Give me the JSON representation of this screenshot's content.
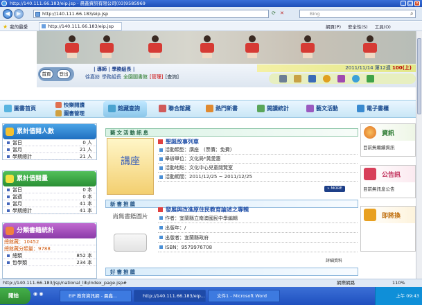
{
  "browser": {
    "title": "http://140.111.66.183/eip.jsp - 晨鑫資訊有限公司(03)9585969",
    "url": "http://140.111.66.183/eip.jsp",
    "search_placeholder": "Bing",
    "favorites": "我的最愛",
    "tab": "http://140.111.66.183/eip.jsp",
    "toolbar": [
      "網頁(P)",
      "安全性(S)",
      "工具(O)"
    ],
    "status": "http://140.111.66.183/jsp/national_lib/index_page.jsp#",
    "status_zone": "網際網路",
    "zoom": "110%"
  },
  "header": {
    "home": "首頁",
    "logout": "登出",
    "role": "| 導師 | 學務組長 |",
    "user_name": "徐嘉紡",
    "user_role_text": "學務組長",
    "library": "全園圖書館",
    "manage": "[管理]",
    "query": "[查詢]",
    "date": "2011/11/14 第12週 ",
    "date_extra": "100(上)"
  },
  "menu": {
    "home": "圖書首頁",
    "fast_read": "快樂閱讀",
    "lib_manage": "圖書管理",
    "items": [
      "館藏查詢",
      "聯合館藏",
      "熱門新書",
      "閱讀統計",
      "藝文活動",
      "電子書櫃"
    ]
  },
  "left": {
    "visitors": {
      "title": "累計借閱人數",
      "rows": [
        {
          "label": "當日",
          "value": "0 人"
        },
        {
          "label": "當月",
          "value": "21 人"
        },
        {
          "label": "學期總計",
          "value": "21 人"
        }
      ]
    },
    "borrow": {
      "title": "累計借閱量",
      "rows": [
        {
          "label": "當日",
          "value": "0 本"
        },
        {
          "label": "當週",
          "value": "0 本"
        },
        {
          "label": "當月",
          "value": "41 本"
        },
        {
          "label": "學期總計",
          "value": "41 本"
        }
      ]
    },
    "catalog": {
      "title": "分類書籍統計",
      "total": "總館藏：10452",
      "classified": "總館藏分類量：9788",
      "rows": [
        {
          "label": "總類",
          "value": "852 本"
        },
        {
          "label": "哲學類",
          "value": "234 本"
        }
      ]
    }
  },
  "center": {
    "arts_head": "藝文活動訊息",
    "event_title": "聖誕故事列車",
    "poster_text": "講座",
    "event_rows": [
      "活動類型：講座　(票價：免費)",
      "舉辦單位：文化局*黃愛惠",
      "活動地點：文化中心兒童閱覽室",
      "活動期間：2011/12/25 ~ 2011/12/25"
    ],
    "more": "» MORE",
    "newbook_head": "新書推薦",
    "no_image": "尚無書籍圖片",
    "book_title": "發展與改進原住民教育論述之專輯",
    "book_rows": [
      "作者：宜蘭縣立南澳國民中學編輯",
      "出版年：/",
      "出版者：宜蘭縣政府",
      "ISBN：9579976708"
    ],
    "detail": "詳細資料",
    "goodbook_head": "好書推薦"
  },
  "right": {
    "info_title": "資訊",
    "info_text": "目前無繼續資訊",
    "notice_title": "公告訊",
    "notice_text": "目前無訊息公告",
    "pending_title": "即將換"
  },
  "taskbar": {
    "start": "開始",
    "tasks": [
      "EIP 教育資訊網 - 晨鑫...",
      "http://140.111.66.183/eip...",
      "文件1 - Microsoft Word"
    ],
    "time": "上午 09:43"
  }
}
